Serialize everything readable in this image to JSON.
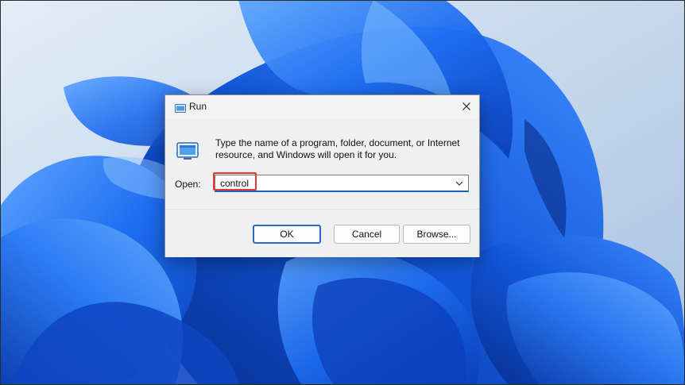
{
  "window": {
    "title": "Run",
    "close_glyph": "✕"
  },
  "icons": {
    "title": "run-icon",
    "program": "program-icon",
    "close": "close-icon",
    "dropdown": "chevron-down-icon"
  },
  "body": {
    "description": "Type the name of a program, folder, document, or Internet resource, and Windows will open it for you.",
    "open_label": "Open:",
    "open_value": "control"
  },
  "buttons": {
    "ok": "OK",
    "cancel": "Cancel",
    "browse": "Browse..."
  },
  "colors": {
    "accent": "#1f5fbf",
    "highlight": "#e03a3a",
    "wallpaper_bg": "#c9d9ec",
    "wallpaper_blue": "#1060e0"
  }
}
